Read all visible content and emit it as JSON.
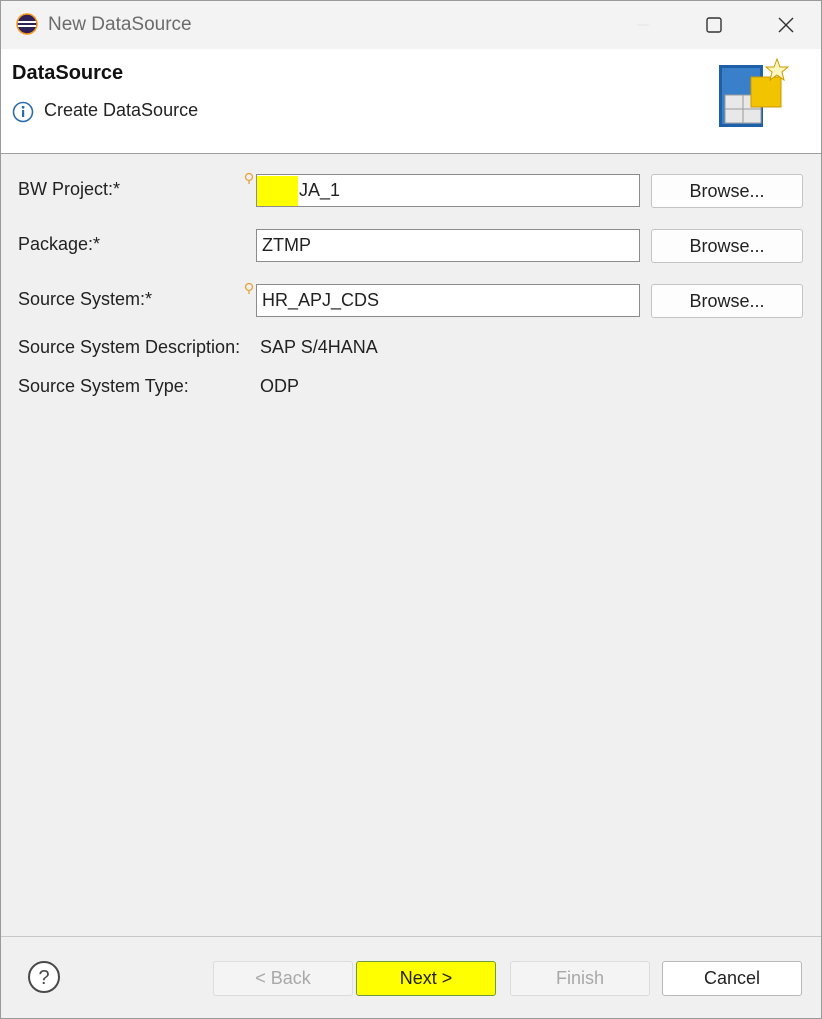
{
  "window": {
    "title": "New DataSource"
  },
  "header": {
    "title": "DataSource",
    "subtitle": "Create DataSource",
    "info_icon": "info-icon",
    "graphic_icon": "datasource-wizard-graphic"
  },
  "form": {
    "bw_project": {
      "label": "BW Project:*",
      "value": "JA_1",
      "browse_label": "Browse..."
    },
    "package": {
      "label": "Package:*",
      "value": "ZTMP",
      "browse_label": "Browse..."
    },
    "source_system": {
      "label": "Source System:*",
      "value": "HR_APJ_CDS",
      "browse_label": "Browse..."
    },
    "source_system_description": {
      "label": "Source System Description:",
      "value": "SAP S/4HANA"
    },
    "source_system_type": {
      "label": "Source System Type:",
      "value": "ODP"
    }
  },
  "footer": {
    "back_label": "< Back",
    "next_label": "Next >",
    "finish_label": "Finish",
    "cancel_label": "Cancel",
    "help_icon": "help-icon"
  },
  "colors": {
    "highlight": "#ffff00",
    "window_bg": "#f0f0f0",
    "header_bg": "#ffffff",
    "disabled_text": "#a8a8a8"
  }
}
